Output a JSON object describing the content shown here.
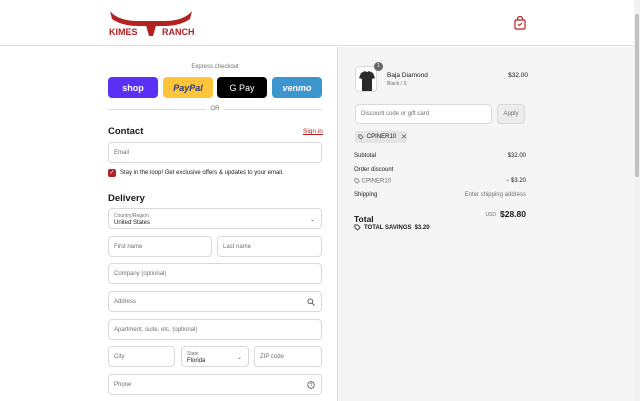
{
  "header": {
    "logo_text": "KIMES RANCH",
    "brand_color": "#b22222"
  },
  "express": {
    "label": "Express checkout",
    "shop": "shop",
    "paypal": "PayPal",
    "gpay": "G Pay",
    "venmo": "venmo",
    "or": "OR"
  },
  "contact": {
    "title": "Contact",
    "signin": "Sign in",
    "email_placeholder": "Email",
    "newsletter_label": "Stay in the loop! Get exclusive offers & updates to your email.",
    "newsletter_checked": true
  },
  "delivery": {
    "title": "Delivery",
    "country_label": "Country/Region",
    "country_value": "United States",
    "first_name": "First name",
    "last_name": "Last name",
    "company": "Company (optional)",
    "address": "Address",
    "apartment": "Apartment, suite, etc. (optional)",
    "city": "City",
    "state_label": "State",
    "state_value": "Florida",
    "zip": "ZIP code",
    "phone": "Phone"
  },
  "summary": {
    "product": {
      "name": "Baja Diamond",
      "variant": "Black / S",
      "price": "$32.00",
      "qty": "1"
    },
    "discount_placeholder": "Discount code or gift card",
    "apply": "Apply",
    "code_tag": "CPINER10",
    "subtotal_label": "Subtotal",
    "subtotal": "$32.00",
    "order_discount_label": "Order discount",
    "discount_code": "CPINER10",
    "discount_amount": "− $3.20",
    "shipping_label": "Shipping",
    "shipping_value": "Enter shipping address",
    "total_label": "Total",
    "currency": "USD",
    "total": "$28.80",
    "savings_label": "TOTAL SAVINGS",
    "savings_amount": "$3.20"
  }
}
